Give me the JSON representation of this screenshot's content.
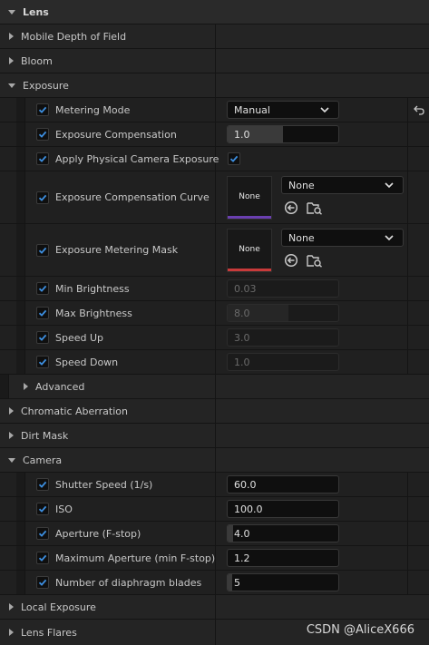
{
  "lens_header": "Lens",
  "sections": {
    "mobile_dof": "Mobile Depth of Field",
    "bloom": "Bloom",
    "exposure": "Exposure",
    "advanced": "Advanced",
    "chromatic": "Chromatic Aberration",
    "dirt_mask": "Dirt Mask",
    "camera": "Camera",
    "local_exposure": "Local Exposure",
    "lens_flares": "Lens Flares"
  },
  "exposure": {
    "metering_mode": {
      "label": "Metering Mode",
      "value": "Manual"
    },
    "exposure_compensation": {
      "label": "Exposure Compensation",
      "value": "1.0",
      "fill": 0.5
    },
    "apply_physical": {
      "label": "Apply Physical Camera Exposure",
      "checked": true
    },
    "comp_curve": {
      "label": "Exposure Compensation Curve",
      "thumb": "None",
      "value": "None",
      "bar_color": "#6a3fb0"
    },
    "metering_mask": {
      "label": "Exposure Metering Mask",
      "thumb": "None",
      "value": "None",
      "bar_color": "#c83a3a"
    },
    "min_brightness": {
      "label": "Min Brightness",
      "value": "0.03",
      "fill": 0.0
    },
    "max_brightness": {
      "label": "Max Brightness",
      "value": "8.0",
      "fill": 0.55
    },
    "speed_up": {
      "label": "Speed Up",
      "value": "3.0",
      "fill": 0.0
    },
    "speed_down": {
      "label": "Speed Down",
      "value": "1.0",
      "fill": 0.0
    }
  },
  "camera": {
    "shutter_speed": {
      "label": "Shutter Speed (1/s)",
      "value": "60.0",
      "fill": 0.0
    },
    "iso": {
      "label": "ISO",
      "value": "100.0",
      "fill": 0.0
    },
    "aperture": {
      "label": "Aperture (F-stop)",
      "value": "4.0",
      "fill": 0.05
    },
    "max_aperture": {
      "label": "Maximum Aperture (min F-stop)",
      "value": "1.2",
      "fill": 0.0
    },
    "blades": {
      "label": "Number of diaphragm blades",
      "value": "5",
      "fill": 0.04
    }
  },
  "watermark": "CSDN @AliceX666",
  "colors": {
    "checkbox_check": "#3d8fe0",
    "background": "#1f1f1f"
  },
  "icons": [
    "reset-arrow-icon",
    "use-selected-icon",
    "browse-folder-icon",
    "chevron-down-icon",
    "checkmark-icon"
  ]
}
